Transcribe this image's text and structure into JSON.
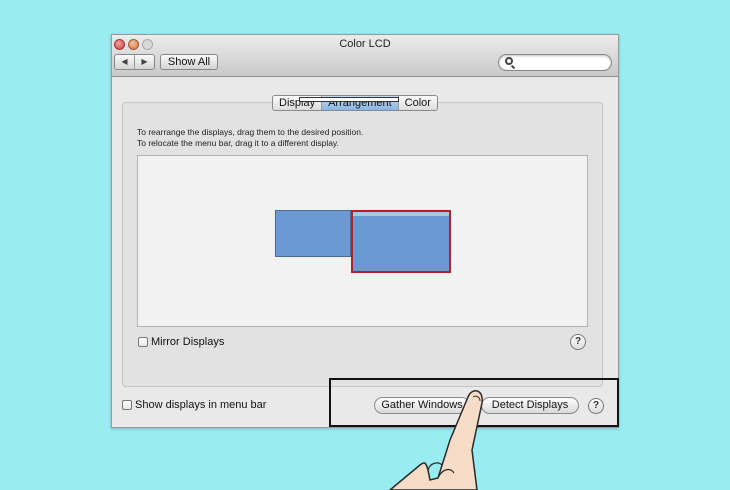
{
  "window": {
    "title": "Color LCD",
    "back_glyph": "◀",
    "forward_glyph": "▶",
    "show_all_label": "Show All",
    "search_placeholder": ""
  },
  "tabs": [
    {
      "label": "Display",
      "active": false
    },
    {
      "label": "Arrangement",
      "active": true
    },
    {
      "label": "Color",
      "active": false
    }
  ],
  "instructions": {
    "line1": "To rearrange the displays, drag them to the desired position.",
    "line2": "To relocate the menu bar, drag it to a different display."
  },
  "arrangement": {
    "display_color": "#6c99d4",
    "selected_border_color": "#b5202a"
  },
  "mirror_displays": {
    "label": "Mirror Displays",
    "checked": false
  },
  "show_in_menu_bar": {
    "label": "Show displays in menu bar",
    "checked": false
  },
  "buttons": {
    "gather_windows": "Gather Windows",
    "detect_displays": "Detect Displays",
    "help": "?"
  },
  "colors": {
    "background": "#98ecf2",
    "active_tab": "#8ab6e2",
    "highlight_box": "#111111"
  },
  "icons": [
    "close-icon",
    "minimize-icon",
    "zoom-icon",
    "back-arrow-icon",
    "forward-arrow-icon",
    "search-icon",
    "help-icon",
    "pointing-hand-icon"
  ]
}
